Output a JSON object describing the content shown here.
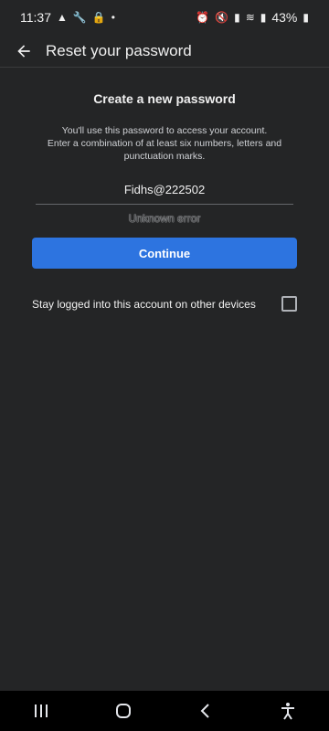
{
  "status_bar": {
    "time": "11:37",
    "battery": "43%",
    "left_icons": [
      "warning-icon",
      "wrench-icon",
      "lock-icon",
      "dot-icon"
    ],
    "right_icons": [
      "alarm-icon",
      "mute-icon",
      "signal-icon",
      "wifi-icon",
      "signal-icon",
      "battery-icon"
    ]
  },
  "app_bar": {
    "title": "Reset your password"
  },
  "main": {
    "heading": "Create a new password",
    "description_line1": "You'll use this password to access your account.",
    "description_line2": "Enter a combination of at least six numbers, letters and",
    "description_line3": "punctuation marks.",
    "password_value": "Fidhs@222502",
    "error_text": "Unknown error",
    "continue_label": "Continue",
    "stay_logged_label": "Stay logged into this account on other devices",
    "stay_logged_checked": false
  },
  "nav_bar": {
    "icons": [
      "recent-apps-icon",
      "home-icon",
      "back-icon",
      "accessibility-icon"
    ]
  },
  "colors": {
    "background": "#242526",
    "primary_button": "#2d74e0",
    "navbar": "#000000"
  }
}
